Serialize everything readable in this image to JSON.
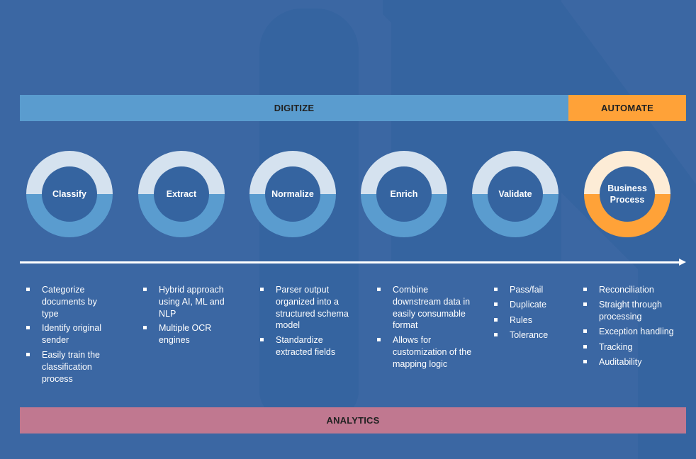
{
  "bands": {
    "digitize": "DIGITIZE",
    "automate": "AUTOMATE",
    "analytics": "ANALYTICS"
  },
  "colors": {
    "background": "#3b67a3",
    "digitize": "#5a9ccf",
    "automate": "#ffa238",
    "analytics": "#c07890",
    "ring_light_blue": "#d5e2ef",
    "ring_light_orange": "#fdecd6"
  },
  "steps": [
    {
      "label": "Classify",
      "bullets": [
        "Categorize documents by type",
        "Identify original sender",
        "Easily train the classification process"
      ]
    },
    {
      "label": "Extract",
      "bullets": [
        "Hybrid approach using AI, ML and NLP",
        "Multiple OCR engines"
      ]
    },
    {
      "label": "Normalize",
      "bullets": [
        "Parser output organized into a structured schema model",
        "Standardize extracted fields"
      ]
    },
    {
      "label": "Enrich",
      "bullets": [
        "Combine downstream data in easily consumable format",
        "Allows for customization of the mapping logic"
      ]
    },
    {
      "label": "Validate",
      "bullets": [
        "Pass/fail",
        "Duplicate",
        "Rules",
        "Tolerance"
      ]
    },
    {
      "label": "Business Process",
      "bullets": [
        "Reconciliation",
        "Straight through processing",
        "Exception handling",
        "Tracking",
        "Auditability"
      ]
    }
  ]
}
